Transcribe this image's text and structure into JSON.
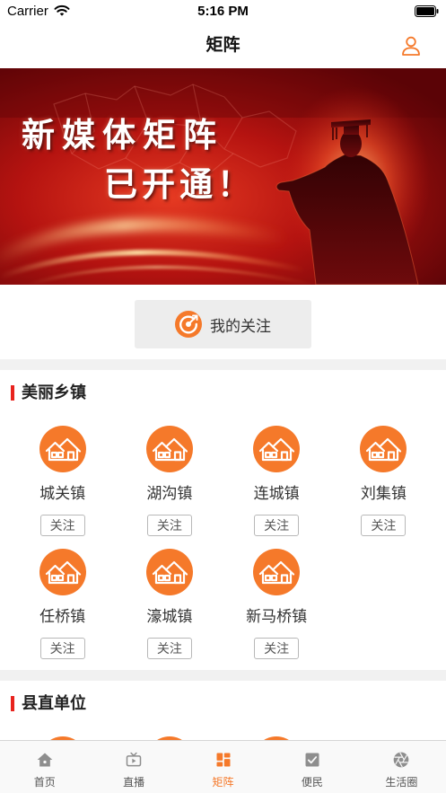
{
  "status_bar": {
    "carrier": "Carrier",
    "time": "5:16 PM",
    "wifi_icon": "wifi-icon",
    "battery_icon": "battery-icon"
  },
  "nav": {
    "title": "矩阵",
    "profile_icon": "user-icon"
  },
  "banner": {
    "headline": "新媒体矩阵",
    "subline": "已开通！"
  },
  "my_follow": {
    "label": "我的关注",
    "icon": "target-icon"
  },
  "sections": [
    {
      "title": "美丽乡镇",
      "items": [
        {
          "name": "城关镇",
          "icon": "house-icon",
          "follow_label": "关注"
        },
        {
          "name": "湖沟镇",
          "icon": "house-icon",
          "follow_label": "关注"
        },
        {
          "name": "连城镇",
          "icon": "house-icon",
          "follow_label": "关注"
        },
        {
          "name": "刘集镇",
          "icon": "house-icon",
          "follow_label": "关注"
        },
        {
          "name": "任桥镇",
          "icon": "house-icon",
          "follow_label": "关注"
        },
        {
          "name": "濠城镇",
          "icon": "house-icon",
          "follow_label": "关注"
        },
        {
          "name": "新马桥镇",
          "icon": "house-icon",
          "follow_label": "关注"
        }
      ]
    },
    {
      "title": "县直单位",
      "items": [
        {
          "icon": "house-icon"
        },
        {
          "icon": "house-icon"
        },
        {
          "icon": "house-icon"
        }
      ]
    }
  ],
  "tab_bar": {
    "items": [
      {
        "label": "首页",
        "icon": "home-icon",
        "active": false
      },
      {
        "label": "直播",
        "icon": "tv-icon",
        "active": false
      },
      {
        "label": "矩阵",
        "icon": "grid-icon",
        "active": true
      },
      {
        "label": "便民",
        "icon": "checkbox-icon",
        "active": false
      },
      {
        "label": "生活圈",
        "icon": "aperture-icon",
        "active": false
      }
    ]
  },
  "colors": {
    "accent": "#f5792a",
    "section_marker": "#e8231e",
    "separator": "#f1f1f1",
    "tab_inactive": "#8e8e8e"
  }
}
